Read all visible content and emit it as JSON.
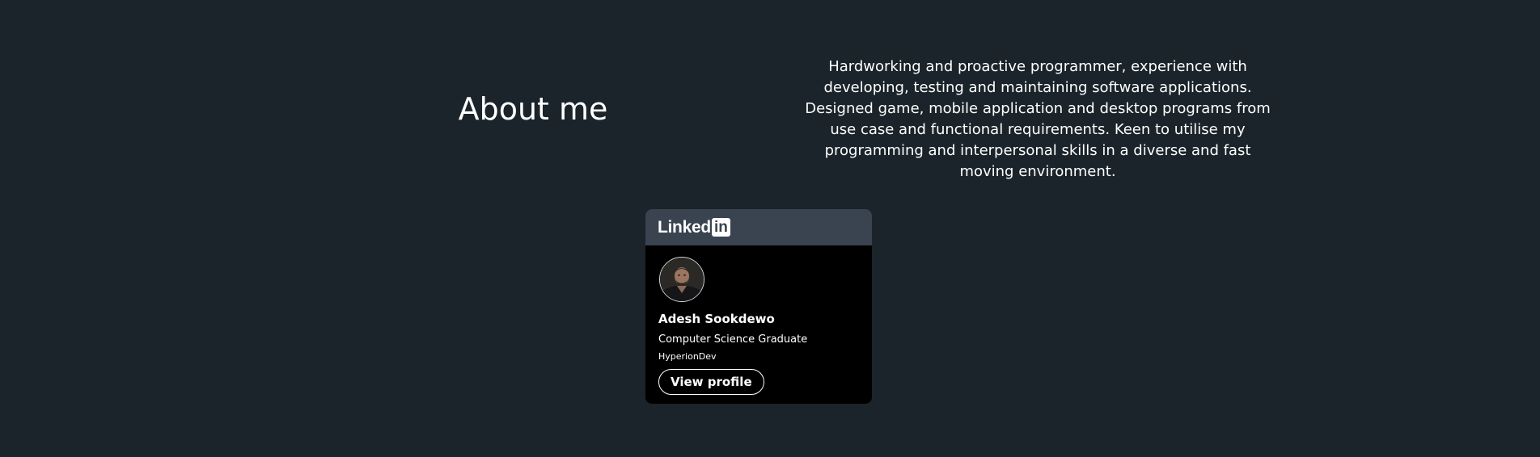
{
  "about": {
    "heading": "About me",
    "text": "Hardworking and proactive programmer, experience with developing, testing and maintaining software applications. Designed game, mobile application and desktop programs from use case and functional requirements. Keen to utilise my programming and interpersonal skills in a diverse and fast moving environment."
  },
  "linkedin_badge": {
    "logo_word": "Linked",
    "logo_box": "in",
    "name": "Adesh Sookdewo",
    "title": "Computer Science Graduate",
    "company": "HyperionDev",
    "button_label": "View profile"
  },
  "colors": {
    "page_background": "#1a242a",
    "badge_header": "#3a4350",
    "badge_body": "#000000",
    "text": "#ffffff"
  }
}
